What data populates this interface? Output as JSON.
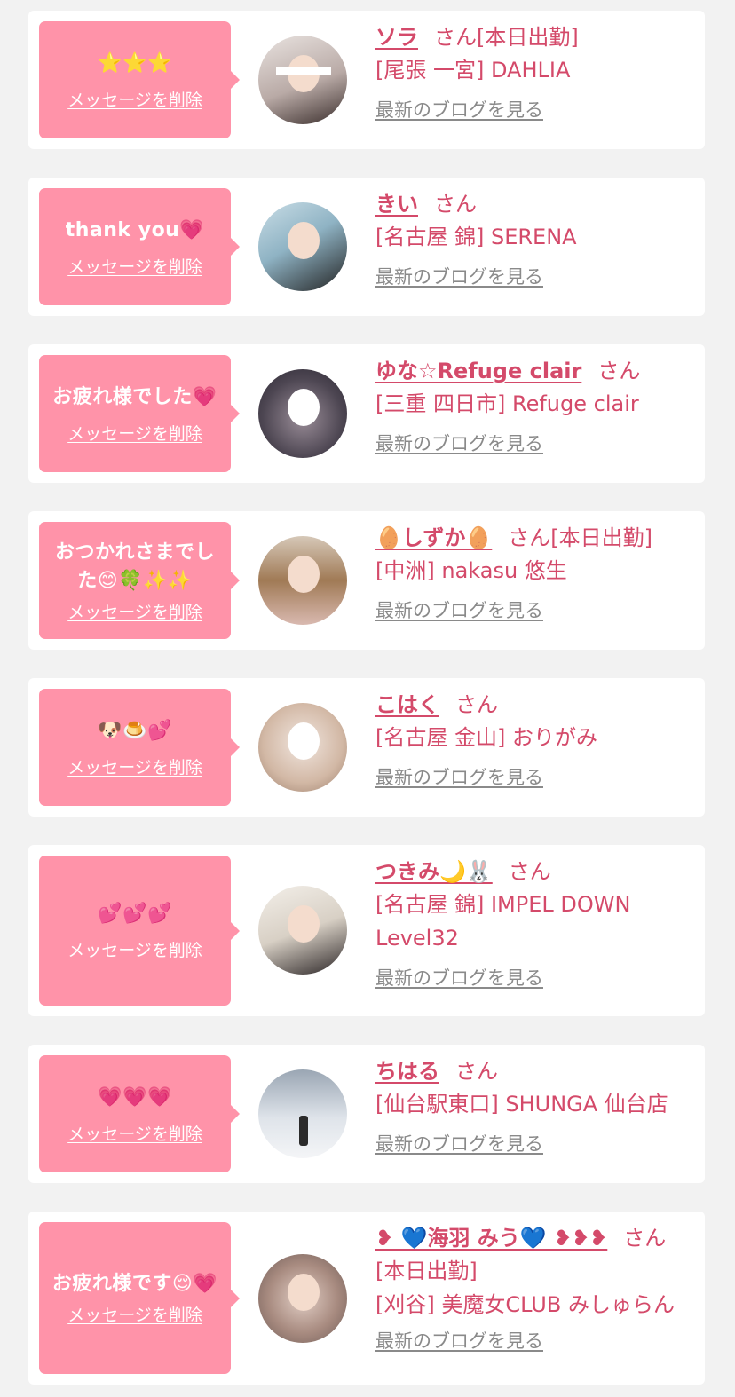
{
  "blog_link_label": "最新のブログを見る",
  "delete_label": "メッセージを削除",
  "san_label": "さん",
  "colors": {
    "background": "#f2f2f2",
    "card": "#ffffff",
    "bubble": "#ff93a9",
    "name": "#d44a6a",
    "link_gray": "#8a8a8a"
  },
  "messages": [
    {
      "message": "⭐⭐⭐",
      "name": "ソラ",
      "status": "[本日出勤]",
      "shop_lines": [
        "[尾張 一宮] DAHLIA"
      ],
      "avatar_icon": "avatar-photo"
    },
    {
      "message": "thank you💗",
      "name": "きい",
      "status": "",
      "shop_lines": [
        "[名古屋 錦] SERENA"
      ],
      "avatar_icon": "avatar-photo"
    },
    {
      "message": "お疲れ様でした💗",
      "name": "ゆな☆Refuge clair",
      "status": "",
      "shop_lines": [
        "[三重 四日市] Refuge clair"
      ],
      "avatar_icon": "avatar-photo"
    },
    {
      "message": "おつかれさまでした😊🍀✨✨",
      "name": "🥚しずか🥚",
      "status": "[本日出勤]",
      "shop_lines": [
        "[中洲] nakasu 悠生"
      ],
      "avatar_icon": "avatar-photo"
    },
    {
      "message": "🐶🍮💕",
      "name": "こはく",
      "status": "",
      "shop_lines": [
        "[名古屋 金山] おりがみ"
      ],
      "avatar_icon": "avatar-photo"
    },
    {
      "message": "💕💕💕",
      "name": "つきみ🌙🐰",
      "status": "",
      "shop_lines": [
        "[名古屋 錦] IMPEL DOWN",
        "Level32"
      ],
      "avatar_icon": "avatar-photo"
    },
    {
      "message": "💗💗💗",
      "name": "ちはる",
      "status": "",
      "shop_lines": [
        "[仙台駅東口] SHUNGA 仙台店"
      ],
      "avatar_icon": "avatar-photo"
    },
    {
      "message": "お疲れ様です😌💗",
      "name": "❥ 💙海羽 みう💙 ❥❥❥",
      "status": "",
      "shop_lines": [
        "[本日出勤]",
        "[刈谷] 美魔女CLUB みしゅらん"
      ],
      "avatar_icon": "avatar-photo"
    }
  ]
}
